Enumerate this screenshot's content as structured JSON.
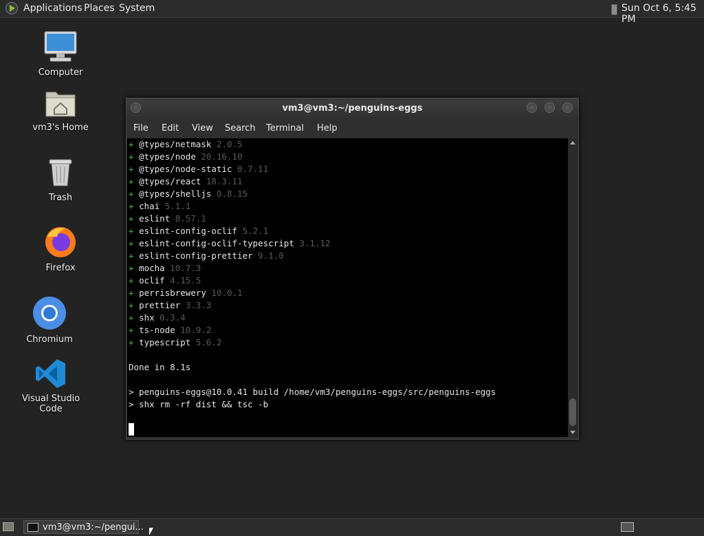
{
  "top_panel": {
    "menus": [
      "Applications",
      "Places",
      "System"
    ],
    "clock": "Sun Oct  6,  5:45 PM"
  },
  "desktop": {
    "icons": [
      {
        "label": "Computer",
        "icon": "computer-icon"
      },
      {
        "label": "vm3's Home",
        "icon": "home-folder-icon"
      },
      {
        "label": "Trash",
        "icon": "trash-icon"
      },
      {
        "label": "Firefox",
        "icon": "firefox-icon"
      },
      {
        "label": "Chromium",
        "icon": "chromium-icon"
      },
      {
        "label": "Visual Studio Code",
        "icon": "vscode-icon"
      }
    ]
  },
  "terminal": {
    "title": "vm3@vm3:~/penguins-eggs",
    "menu": [
      "File",
      "Edit",
      "View",
      "Search",
      "Terminal",
      "Help"
    ],
    "packages": [
      {
        "name": "@types/netmask",
        "version": "2.0.5"
      },
      {
        "name": "@types/node",
        "version": "20.16.10"
      },
      {
        "name": "@types/node-static",
        "version": "0.7.11"
      },
      {
        "name": "@types/react",
        "version": "18.3.11"
      },
      {
        "name": "@types/shelljs",
        "version": "0.8.15"
      },
      {
        "name": "chai",
        "version": "5.1.1"
      },
      {
        "name": "eslint",
        "version": "8.57.1"
      },
      {
        "name": "eslint-config-oclif",
        "version": "5.2.1"
      },
      {
        "name": "eslint-config-oclif-typescript",
        "version": "3.1.12"
      },
      {
        "name": "eslint-config-prettier",
        "version": "9.1.0"
      },
      {
        "name": "mocha",
        "version": "10.7.3"
      },
      {
        "name": "oclif",
        "version": "4.15.5"
      },
      {
        "name": "perrisbrewery",
        "version": "10.0.1"
      },
      {
        "name": "prettier",
        "version": "3.3.3"
      },
      {
        "name": "shx",
        "version": "0.3.4"
      },
      {
        "name": "ts-node",
        "version": "10.9.2"
      },
      {
        "name": "typescript",
        "version": "5.6.2"
      }
    ],
    "done_line": "Done in 8.1s",
    "cmd_line_1": "> penguins-eggs@10.0.41 build /home/vm3/penguins-eggs/src/penguins-eggs",
    "cmd_line_2": "> shx rm -rf dist && tsc -b"
  },
  "bottom_panel": {
    "task_label": "vm3@vm3:~/pengui..."
  }
}
